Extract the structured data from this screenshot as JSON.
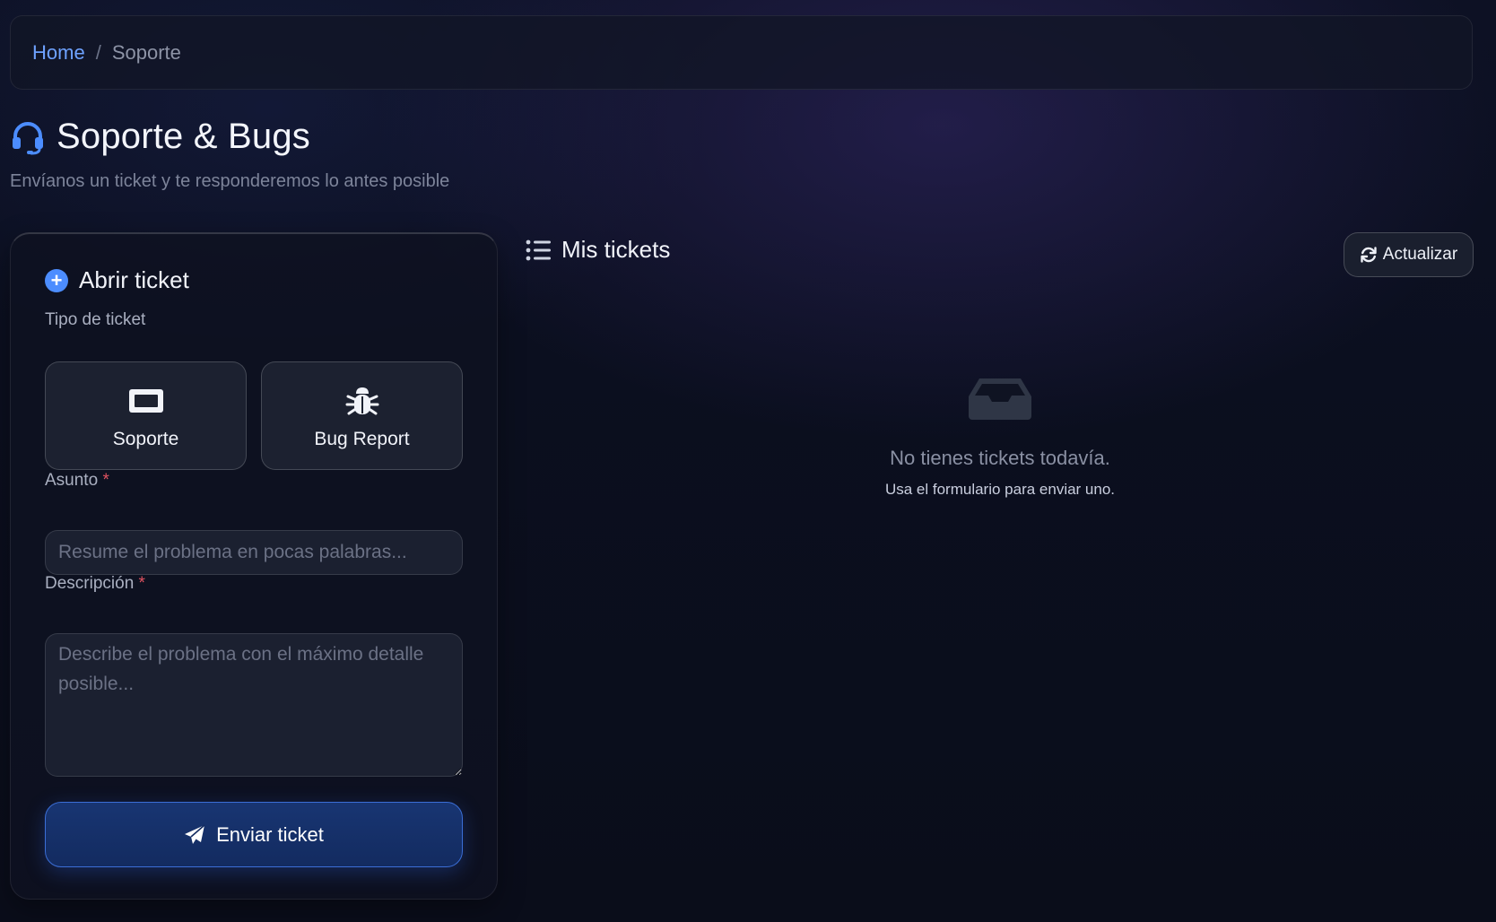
{
  "breadcrumb": {
    "home": "Home",
    "separator": "/",
    "current": "Soporte"
  },
  "page": {
    "title": "Soporte & Bugs",
    "subtitle": "Envíanos un ticket y te responderemos lo antes posible",
    "icon": "headset-icon"
  },
  "form": {
    "heading": "Abrir ticket",
    "heading_icon": "plus-circle-icon",
    "type_label": "Tipo de ticket",
    "types": [
      {
        "label": "Soporte",
        "icon": "ticket-icon"
      },
      {
        "label": "Bug Report",
        "icon": "bug-icon"
      }
    ],
    "subject_label": "Asunto",
    "subject_placeholder": "Resume el problema en pocas palabras...",
    "description_label": "Descripción",
    "description_placeholder": "Describe el problema con el máximo detalle posible...",
    "required_mark": "*",
    "submit_label": "Enviar ticket",
    "submit_icon": "paper-plane-icon"
  },
  "tickets": {
    "heading": "Mis tickets",
    "heading_icon": "list-icon",
    "refresh_label": "Actualizar",
    "refresh_icon": "refresh-icon",
    "empty_icon": "inbox-icon",
    "empty_title": "No tienes tickets todavía.",
    "empty_hint": "Usa el formulario para enviar uno."
  },
  "colors": {
    "accent": "#4c8dff",
    "link": "#6ea2ff",
    "required": "#e05260",
    "submit_bg": "#183572"
  }
}
